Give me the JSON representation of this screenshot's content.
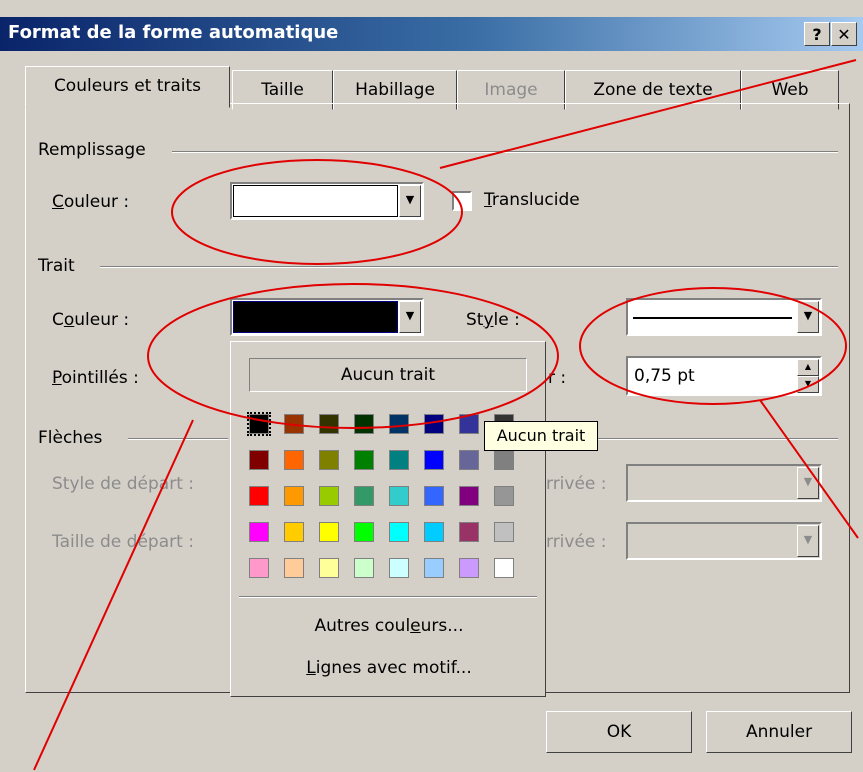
{
  "dialog": {
    "title": "Format de la forme automatique",
    "help_label": "?",
    "close_label": "✕"
  },
  "tabs": [
    {
      "label": "Couleurs et traits"
    },
    {
      "label": "Taille"
    },
    {
      "label": "Habillage"
    },
    {
      "label": "Image"
    },
    {
      "label": "Zone de texte"
    },
    {
      "label": "Web"
    }
  ],
  "fill": {
    "section": "Remplissage",
    "color_label": "Couleur :",
    "color_value": "#ffffff",
    "translucent_label": "Translucide",
    "translucent_checked": false
  },
  "line": {
    "section": "Trait",
    "color_label": "Couleur :",
    "color_value": "#000000",
    "style_label": "Style :",
    "dashed_label": "Pointillés :",
    "weight_label": "r :",
    "weight_value": "0,75  pt"
  },
  "arrows": {
    "section": "Flèches",
    "start_style": "Style de départ :",
    "start_size": "Taille de départ :",
    "end_style_partial": "rrivée :",
    "end_size_partial": "rrivée :"
  },
  "popup": {
    "no_line": "Aucun trait",
    "more_colors": "Autres couleurs...",
    "patterned_lines": "Lignes avec motif...",
    "swatches": [
      [
        "#000000",
        "#993300",
        "#333300",
        "#003300",
        "#003366",
        "#000080",
        "#333399",
        "#333333"
      ],
      [
        "#800000",
        "#ff6600",
        "#808000",
        "#008000",
        "#008080",
        "#0000ff",
        "#666699",
        "#808080"
      ],
      [
        "#ff0000",
        "#ff9900",
        "#99cc00",
        "#339966",
        "#33cccc",
        "#3366ff",
        "#800080",
        "#969696"
      ],
      [
        "#ff00ff",
        "#ffcc00",
        "#ffff00",
        "#00ff00",
        "#00ffff",
        "#00ccff",
        "#993366",
        "#c0c0c0"
      ],
      [
        "#ff99cc",
        "#ffcc99",
        "#ffff99",
        "#ccffcc",
        "#ccffff",
        "#99ccff",
        "#cc99ff",
        "#ffffff"
      ]
    ]
  },
  "tooltip": "Aucun trait",
  "buttons": {
    "ok": "OK",
    "cancel": "Annuler"
  },
  "colors": {
    "annotation": "#e00000",
    "titlebar_start": "#0a246a",
    "face": "#d4d0c8"
  }
}
